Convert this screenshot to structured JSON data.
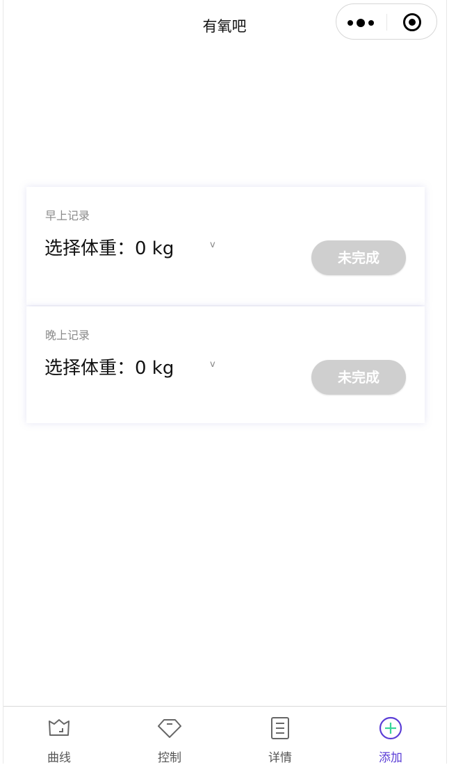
{
  "header": {
    "title": "有氧吧"
  },
  "capsule": {
    "more_icon": "more-dots-icon",
    "close_icon": "target-circle-icon"
  },
  "records": [
    {
      "label": "早上记录",
      "weight_text": "选择体重：0 kg",
      "caret": "v",
      "status": "未完成"
    },
    {
      "label": "晚上记录",
      "weight_text": "选择体重：0 kg",
      "caret": "v",
      "status": "未完成"
    }
  ],
  "tabbar": {
    "items": [
      {
        "label": "曲线",
        "icon": "curve-icon"
      },
      {
        "label": "控制",
        "icon": "diamond-icon"
      },
      {
        "label": "详情",
        "icon": "document-icon"
      },
      {
        "label": "添加",
        "icon": "plus-circle-icon",
        "active": true
      }
    ]
  },
  "colors": {
    "active": "#5b3ed6",
    "button_disabled": "#cfcfcf",
    "plus_green": "#3ad69a"
  }
}
